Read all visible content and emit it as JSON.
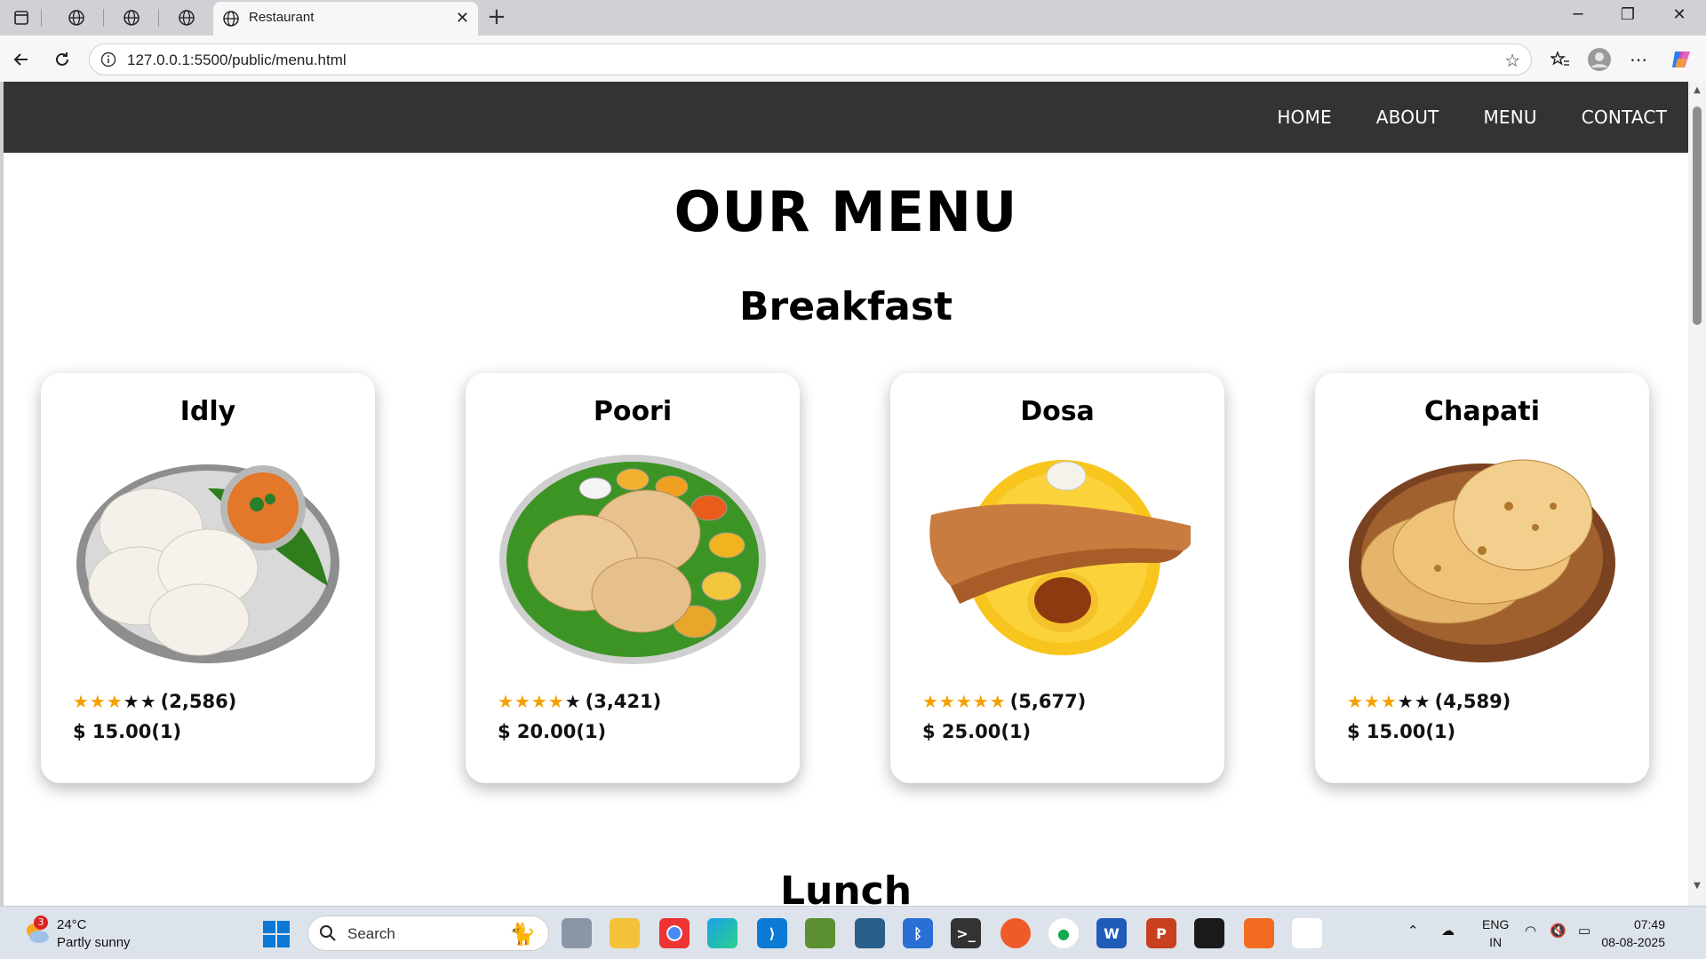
{
  "browser": {
    "tab_title": "Restaurant",
    "url": "127.0.0.1:5500/public/menu.html"
  },
  "nav": {
    "links": [
      "HOME",
      "ABOUT",
      "MENU",
      "CONTACT"
    ]
  },
  "page": {
    "title": "OUR MENU",
    "sections": [
      "Breakfast",
      "Lunch"
    ]
  },
  "items": [
    {
      "name": "Idly",
      "rating_stars": 3,
      "reviews": "(2,586)",
      "price": "$ 15.00(1)",
      "image": "idly-plate-icon"
    },
    {
      "name": "Poori",
      "rating_stars": 4,
      "reviews": "(3,421)",
      "price": "$ 20.00(1)",
      "image": "poori-thali-icon"
    },
    {
      "name": "Dosa",
      "rating_stars": 5,
      "reviews": "(5,677)",
      "price": "$ 25.00(1)",
      "image": "dosa-plate-icon"
    },
    {
      "name": "Chapati",
      "rating_stars": 3,
      "reviews": "(4,589)",
      "price": "$ 15.00(1)",
      "image": "chapati-plate-icon"
    }
  ],
  "taskbar": {
    "weather_temp": "24°C",
    "weather_cond": "Partly sunny",
    "weather_badge": "3",
    "search_placeholder": "Search",
    "lang_line1": "ENG",
    "lang_line2": "IN",
    "time": "07:49",
    "date": "08-08-2025"
  },
  "colors": {
    "navbar": "#333333",
    "star_on": "#f5a000",
    "star_off": "#111111"
  }
}
